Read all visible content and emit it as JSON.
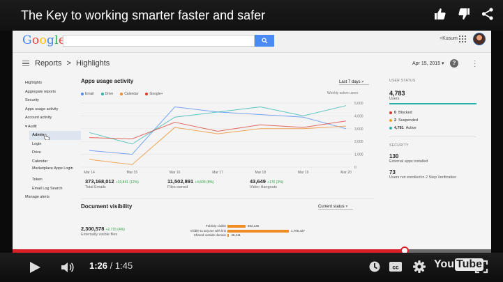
{
  "video": {
    "title": "The Key to working smarter faster and safer",
    "current_time": "1:26",
    "duration": "1:45",
    "progress_fraction": 0.819
  },
  "google": {
    "user": "+Kusum"
  },
  "header": {
    "breadcrumb": [
      "Reports",
      ">",
      "Highlights"
    ],
    "date": "Apr 15, 2015",
    "date_caret": "▾"
  },
  "nav": {
    "items": [
      {
        "label": "Highlights",
        "level": 0
      },
      {
        "label": "Aggregate reports",
        "level": 0
      },
      {
        "label": "Security",
        "level": 0
      },
      {
        "label": "Apps usage activity",
        "level": 0
      },
      {
        "label": "Account activity",
        "level": 0
      },
      {
        "label": "▾ Audit",
        "level": 0
      },
      {
        "label": "Admin",
        "level": 1,
        "selected": true
      },
      {
        "label": "Login",
        "level": 1
      },
      {
        "label": "Drive",
        "level": 1
      },
      {
        "label": "Calendar",
        "level": 1
      },
      {
        "label": "Marketplace Apps Login",
        "level": 1,
        "twoline": true
      },
      {
        "label": "Token",
        "level": 1
      },
      {
        "label": "Email Log Search",
        "level": 1
      },
      {
        "label": "Manage alerts",
        "level": 0
      }
    ]
  },
  "usage": {
    "title": "Apps usage activity",
    "range": "Last 7 days",
    "right_axis_label": "Weekly active users",
    "legend": [
      {
        "name": "Email",
        "color": "#4a8af4"
      },
      {
        "name": "Drive",
        "color": "#2bb3ad"
      },
      {
        "name": "Calendar",
        "color": "#f08a24"
      },
      {
        "name": "Google+",
        "color": "#d93a2b"
      }
    ]
  },
  "chart_data": {
    "type": "line",
    "x": [
      "Mar 14",
      "Mar 15",
      "Mar 16",
      "Mar 17",
      "Mar 18",
      "Mar 19",
      "Mar 20"
    ],
    "y_ticks": [
      "0",
      "1,000",
      "2,000",
      "3,000",
      "4,000",
      "5,000"
    ],
    "ylim": [
      0,
      5000
    ],
    "series": [
      {
        "name": "Email",
        "color": "#4a8af4",
        "values": [
          1300,
          1000,
          4700,
          4300,
          4100,
          3900,
          3000
        ]
      },
      {
        "name": "Drive",
        "color": "#2bb3ad",
        "values": [
          2700,
          1800,
          3900,
          4300,
          4700,
          4000,
          4800
        ]
      },
      {
        "name": "Calendar",
        "color": "#f08a24",
        "values": [
          600,
          200,
          3100,
          2600,
          3000,
          3000,
          3200
        ]
      },
      {
        "name": "Google+",
        "color": "#d93a2b",
        "values": [
          2300,
          2200,
          3500,
          2800,
          3300,
          3100,
          3600
        ]
      }
    ]
  },
  "stats": [
    {
      "value": "373,168,012",
      "delta": "+33,841 (12%)",
      "label": "Total Emails"
    },
    {
      "value": "11,502,891",
      "delta": "+4,605 (8%)",
      "label": "Files owned"
    },
    {
      "value": "43,649",
      "delta": "+176 (3%)",
      "label": "Video Hangouts"
    }
  ],
  "doc_visibility": {
    "title": "Document visibility",
    "filter": "Current status",
    "total_value": "2,300,578",
    "total_delta": "+2,715 (4%)",
    "total_label": "Externally visible files",
    "bars": [
      {
        "label": "Publicly visible",
        "value": 502146,
        "display": "502,146"
      },
      {
        "label": "Visible to anyone with link",
        "value": 1700427,
        "display": "1,700,427"
      },
      {
        "label": "Shared outside domain",
        "value": 46411,
        "display": "46,411"
      }
    ]
  },
  "user_status": {
    "header": "USER STATUS",
    "total": "4,783",
    "total_label": "Users",
    "rows": [
      {
        "count": "0",
        "label": "Blocked",
        "color": "#d93a2b"
      },
      {
        "count": "2",
        "label": "Suspended",
        "color": "#f0a020"
      },
      {
        "count": "4,781",
        "label": "Active",
        "color": "#2bb3ad"
      }
    ]
  },
  "security": {
    "header": "SECURITY",
    "ext_count": "130",
    "ext_label": "External apps installed",
    "users_count": "73",
    "users_label": "Users not enrolled in 2 Step Verification"
  }
}
